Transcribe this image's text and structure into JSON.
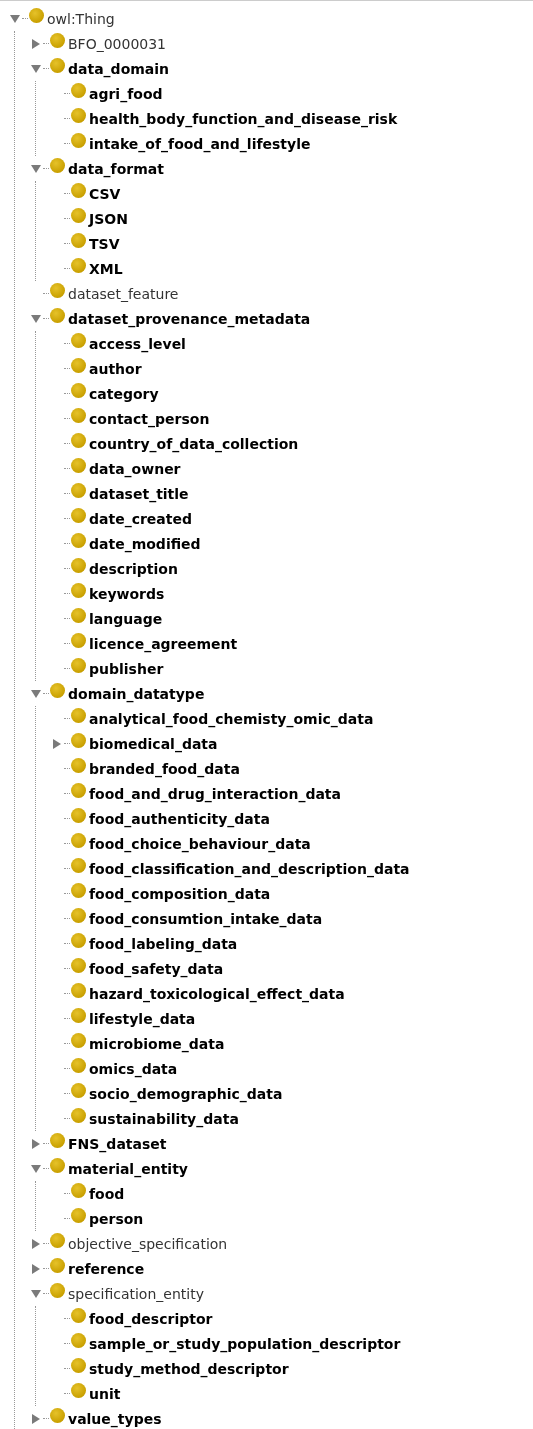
{
  "tree": {
    "items": [
      {
        "label": "owl:Thing",
        "kind": "branch",
        "expanded": true,
        "bold": false,
        "children": [
          {
            "label": "BFO_0000031",
            "kind": "branch",
            "expanded": false,
            "bold": false
          },
          {
            "label": "data_domain",
            "kind": "branch",
            "expanded": true,
            "bold": true,
            "children": [
              {
                "label": "agri_food",
                "kind": "leaf",
                "bold": true
              },
              {
                "label": "health_body_function_and_disease_risk",
                "kind": "leaf",
                "bold": true
              },
              {
                "label": "intake_of_food_and_lifestyle",
                "kind": "leaf",
                "bold": true
              }
            ]
          },
          {
            "label": "data_format",
            "kind": "branch",
            "expanded": true,
            "bold": true,
            "children": [
              {
                "label": "CSV",
                "kind": "leaf",
                "bold": true
              },
              {
                "label": "JSON",
                "kind": "leaf",
                "bold": true
              },
              {
                "label": "TSV",
                "kind": "leaf",
                "bold": true
              },
              {
                "label": "XML",
                "kind": "leaf",
                "bold": true
              }
            ]
          },
          {
            "label": "dataset_feature",
            "kind": "leaf",
            "bold": false
          },
          {
            "label": "dataset_provenance_metadata",
            "kind": "branch",
            "expanded": true,
            "bold": true,
            "children": [
              {
                "label": "access_level",
                "kind": "leaf",
                "bold": true
              },
              {
                "label": "author",
                "kind": "leaf",
                "bold": true
              },
              {
                "label": "category",
                "kind": "leaf",
                "bold": true
              },
              {
                "label": "contact_person",
                "kind": "leaf",
                "bold": true
              },
              {
                "label": "country_of_data_collection",
                "kind": "leaf",
                "bold": true
              },
              {
                "label": "data_owner",
                "kind": "leaf",
                "bold": true
              },
              {
                "label": "dataset_title",
                "kind": "leaf",
                "bold": true
              },
              {
                "label": "date_created",
                "kind": "leaf",
                "bold": true
              },
              {
                "label": "date_modified",
                "kind": "leaf",
                "bold": true
              },
              {
                "label": "description",
                "kind": "leaf",
                "bold": true
              },
              {
                "label": "keywords",
                "kind": "leaf",
                "bold": true
              },
              {
                "label": "language",
                "kind": "leaf",
                "bold": true
              },
              {
                "label": "licence_agreement",
                "kind": "leaf",
                "bold": true
              },
              {
                "label": "publisher",
                "kind": "leaf",
                "bold": true
              }
            ]
          },
          {
            "label": "domain_datatype",
            "kind": "branch",
            "expanded": true,
            "bold": true,
            "children": [
              {
                "label": "analytical_food_chemisty_omic_data",
                "kind": "leaf",
                "bold": true
              },
              {
                "label": "biomedical_data",
                "kind": "branch",
                "expanded": false,
                "bold": true
              },
              {
                "label": "branded_food_data",
                "kind": "leaf",
                "bold": true
              },
              {
                "label": "food_and_drug_interaction_data",
                "kind": "leaf",
                "bold": true
              },
              {
                "label": "food_authenticity_data",
                "kind": "leaf",
                "bold": true
              },
              {
                "label": "food_choice_behaviour_data",
                "kind": "leaf",
                "bold": true
              },
              {
                "label": "food_classification_and_description_data",
                "kind": "leaf",
                "bold": true
              },
              {
                "label": "food_composition_data",
                "kind": "leaf",
                "bold": true
              },
              {
                "label": "food_consumtion_intake_data",
                "kind": "leaf",
                "bold": true
              },
              {
                "label": "food_labeling_data",
                "kind": "leaf",
                "bold": true
              },
              {
                "label": "food_safety_data",
                "kind": "leaf",
                "bold": true
              },
              {
                "label": "hazard_toxicological_effect_data",
                "kind": "leaf",
                "bold": true
              },
              {
                "label": "lifestyle_data",
                "kind": "leaf",
                "bold": true
              },
              {
                "label": "microbiome_data",
                "kind": "leaf",
                "bold": true
              },
              {
                "label": "omics_data",
                "kind": "leaf",
                "bold": true
              },
              {
                "label": "socio_demographic_data",
                "kind": "leaf",
                "bold": true
              },
              {
                "label": "sustainability_data",
                "kind": "leaf",
                "bold": true
              }
            ]
          },
          {
            "label": "FNS_dataset",
            "kind": "branch",
            "expanded": false,
            "bold": true
          },
          {
            "label": "material_entity",
            "kind": "branch",
            "expanded": true,
            "bold": true,
            "children": [
              {
                "label": "food",
                "kind": "leaf",
                "bold": true
              },
              {
                "label": "person",
                "kind": "leaf",
                "bold": true
              }
            ]
          },
          {
            "label": "objective_specification",
            "kind": "branch",
            "expanded": false,
            "bold": false
          },
          {
            "label": "reference",
            "kind": "branch",
            "expanded": false,
            "bold": true
          },
          {
            "label": "specification_entity",
            "kind": "branch",
            "expanded": true,
            "bold": false,
            "children": [
              {
                "label": "food_descriptor",
                "kind": "leaf",
                "bold": true
              },
              {
                "label": "sample_or_study_population_descriptor",
                "kind": "leaf",
                "bold": true
              },
              {
                "label": "study_method_descriptor",
                "kind": "leaf",
                "bold": true
              },
              {
                "label": "unit",
                "kind": "leaf",
                "bold": true
              }
            ]
          },
          {
            "label": "value_types",
            "kind": "branch",
            "expanded": false,
            "bold": true
          }
        ]
      }
    ]
  }
}
